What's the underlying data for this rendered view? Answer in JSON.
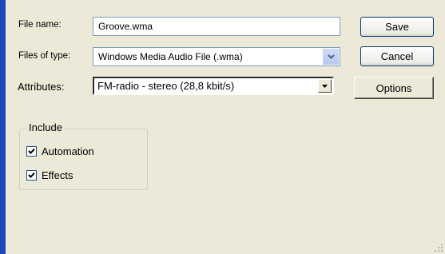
{
  "labels": {
    "file_name": "File name:",
    "files_of_type": "Files of type:",
    "attributes": "Attributes:"
  },
  "fields": {
    "file_name_value": "Groove.wma",
    "file_type_value": "Windows Media Audio File (.wma)",
    "attributes_value": "FM-radio - stereo (28,8 kbit/s)"
  },
  "buttons": {
    "save": "Save",
    "cancel": "Cancel",
    "options": "Options"
  },
  "include_group": {
    "title": "Include",
    "options": [
      {
        "label": "Automation",
        "checked": true
      },
      {
        "label": "Effects",
        "checked": true
      }
    ]
  },
  "icons": [
    "chevron-down-icon",
    "arrow-down-icon",
    "checkmark-icon",
    "resize-grip-icon"
  ]
}
